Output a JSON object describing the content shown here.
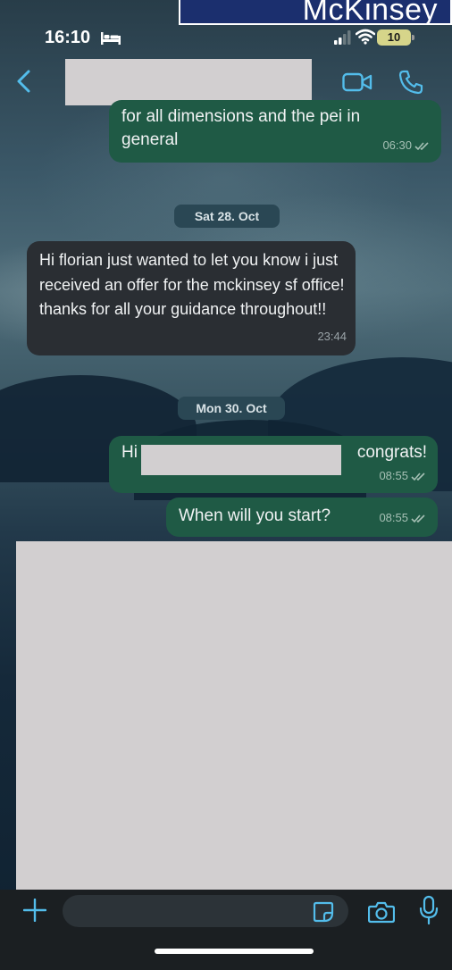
{
  "banner": {
    "text": "McKinsey"
  },
  "status_bar": {
    "time": "16:10",
    "battery": "10"
  },
  "header": {
    "contact_name": ""
  },
  "messages": [
    {
      "direction": "out",
      "text_line1": "for all dimensions and the pei in",
      "text_line2": "general",
      "time": "06:30"
    },
    {
      "direction": "in",
      "text": "Hi florian just wanted to let you know i just received an offer for the mckinsey sf office! thanks for all your guidance throughout!!",
      "time": "23:44"
    },
    {
      "direction": "out",
      "prefix": "Hi",
      "suffix": "congrats!",
      "time": "08:55"
    },
    {
      "direction": "out",
      "text": "When will you start?",
      "time": "08:55"
    }
  ],
  "dates": {
    "sat": "Sat 28. Oct",
    "mon": "Mon 30. Oct"
  },
  "input": {
    "placeholder": ""
  },
  "icons": [
    "bed-icon",
    "signal-icon",
    "wifi-icon",
    "back-icon",
    "video-call-icon",
    "phone-icon",
    "double-check-icon",
    "plus-icon",
    "sticker-icon",
    "camera-icon",
    "microphone-icon"
  ],
  "colors": {
    "outgoing_bubble": "#1f5a45",
    "incoming_bubble": "#2a2e33",
    "accent": "#53bdeb",
    "banner": "#1b2f6e"
  }
}
